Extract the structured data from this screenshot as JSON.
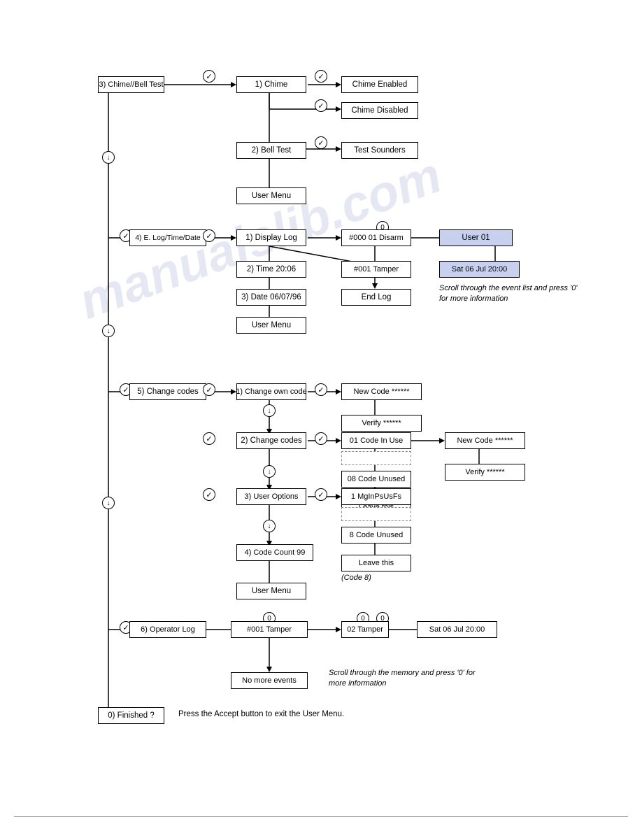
{
  "watermark": "manualslib.com",
  "boxes": {
    "chime_bell_test": "3) Chime//Bell Test",
    "chime": "1) Chime",
    "chime_enabled": "Chime Enabled",
    "chime_disabled": "Chime Disabled",
    "bell_test": "2) Bell Test",
    "test_sounders": "Test Sounders",
    "user_menu_1": "User Menu",
    "elog_time_date": "4) E. Log/Time/Date",
    "display_log": "1) Display Log",
    "time": "2) Time    20:06",
    "date": "3) Date   06/07/96",
    "user_menu_2": "User Menu",
    "event_000": "#000 01 Disarm",
    "event_001": "#001 Tamper",
    "end_log": "End Log",
    "user_01": "User 01",
    "sat_date_1": "Sat 06 Jul 20:00",
    "change_codes_main": "5) Change codes",
    "change_own_code": "1) Change own code",
    "new_code_1": "New Code ******",
    "verify_1": "Verify     ******",
    "change_codes_sub": "2) Change codes",
    "code_01_in_use": "01 Code In Use",
    "dashed_1": "- - - - - - - - - - -",
    "code_08_unused": "08 Code Unused",
    "leave_this_1": "Leave this",
    "new_code_2": "New Code ******",
    "verify_2": "Verify     ******",
    "user_options": "3) User Options",
    "mgln_1": "1 MgInPsUsFs",
    "dashed_2": "- - - - - - - - - - -",
    "code_8_unused": "8 Code Unused",
    "leave_this_2": "Leave this",
    "code_count": "4) Code Count  99",
    "user_menu_3": "User Menu",
    "operator_log": "6) Operator Log",
    "event_001b": "#001 Tamper",
    "tamper_02": "02 Tamper",
    "sat_date_2": "Sat 06 Jul 20:00",
    "no_more_events": "No more events",
    "finished": "0) Finished ?",
    "finished_label": "Press the Accept button to exit  the User Menu.",
    "code8_label": "(Code 8)",
    "scroll_text_1": "Scroll through the event list and\npress '0' for more  information",
    "scroll_text_2": "Scroll through the memory and\npress '0' for more  information"
  }
}
